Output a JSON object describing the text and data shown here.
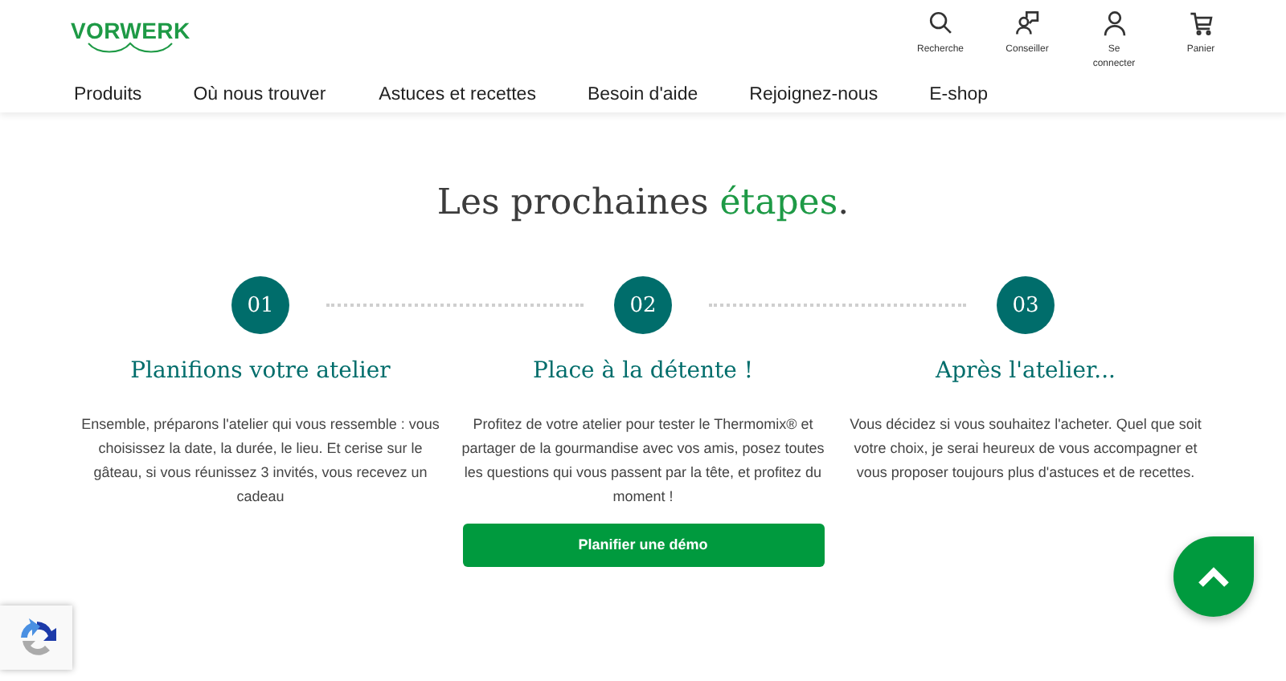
{
  "header": {
    "logo": "VORWERK",
    "actions": [
      {
        "kind": "search",
        "label": "Recherche"
      },
      {
        "kind": "advisor",
        "label": "Conseiller"
      },
      {
        "kind": "user",
        "label": "Se connecter"
      },
      {
        "kind": "cart",
        "label": "Panier"
      }
    ],
    "nav": [
      "Produits",
      "Où nous trouver",
      "Astuces et recettes",
      "Besoin d'aide",
      "Rejoignez-nous",
      "E-shop"
    ]
  },
  "section": {
    "title_start": "Les prochaines ",
    "title_highlight": "étapes",
    "title_end": ".",
    "steps": [
      {
        "number": "01",
        "title": "Planifions votre atelier",
        "text": "Ensemble, préparons l'atelier qui vous ressemble : vous choisissez la date, la durée, le lieu. Et cerise sur le gâteau, si vous réunissez 3 invités, vous recevez un cadeau"
      },
      {
        "number": "02",
        "title": "Place à la détente !",
        "text": "Profitez de votre atelier pour tester le Thermomix® et partager de la gourmandise avec vos amis, posez toutes les questions qui vous passent par la tête, et profitez du moment !",
        "button": "Planifier une démo"
      },
      {
        "number": "03",
        "title": "Après l'atelier...",
        "text": "Vous décidez si vous souhaitez l'acheter. Quel que soit votre choix, je serai heureux de vous accompagner et vous proposer toujours plus d'astuces et de recettes."
      }
    ]
  }
}
